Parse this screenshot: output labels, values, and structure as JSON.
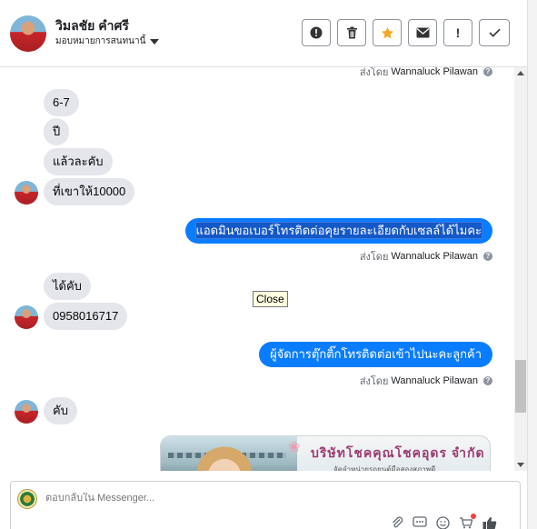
{
  "header": {
    "contact_name": "วิมลชัย คำศรี",
    "assign_label": "มอบหมายการสนทนานี้",
    "toolbar": [
      {
        "name": "spam-button",
        "icon": "alert-circle-icon",
        "glyph": "●"
      },
      {
        "name": "delete-button",
        "icon": "trash-icon",
        "glyph": "🗑"
      },
      {
        "name": "star-button",
        "icon": "star-icon",
        "glyph": "★"
      },
      {
        "name": "mark-unread-button",
        "icon": "envelope-icon",
        "glyph": "✉"
      },
      {
        "name": "follow-up-button",
        "icon": "exclamation-icon",
        "glyph": "!"
      },
      {
        "name": "mark-done-button",
        "icon": "check-icon",
        "glyph": "✓"
      }
    ]
  },
  "chat": {
    "sent_by_prefix": "ส่งโดย",
    "sender_name": "Wannaluck Pilawan",
    "help_glyph": "?",
    "messages": {
      "m1": "6-7",
      "m2": "ปี",
      "m3": "แล้วละคับ",
      "m4": "ที่เขาให้10000",
      "out1": "แอดมินขอเบอร์โทรติดต่อคุยรายละเอียดกับเซลล์ได้ไมคะ",
      "m5": "ได้คับ",
      "m6": "0958016717",
      "out2": "ผู้จัดการตุ๊กติ๊กโทรติดต่อเข้าไปนะคะลูกค้า",
      "m7": "คับ"
    },
    "tooltip": "Close",
    "image_message": {
      "company_name": "บริษัทโชคคุณโชคอุดร จำกัด",
      "company_sub": "จัดจำหน่ายรถยนต์มือสองสภาพดี"
    }
  },
  "composer": {
    "placeholder": "ตอบกลับใน Messenger...",
    "icons": [
      "paperclip-icon",
      "saved-reply-icon",
      "emoji-icon",
      "shop-icon",
      "like-icon"
    ]
  },
  "colors": {
    "outgoing_bubble": "#0a7cff",
    "incoming_bubble": "#e4e6eb",
    "star": "#f5a623"
  }
}
